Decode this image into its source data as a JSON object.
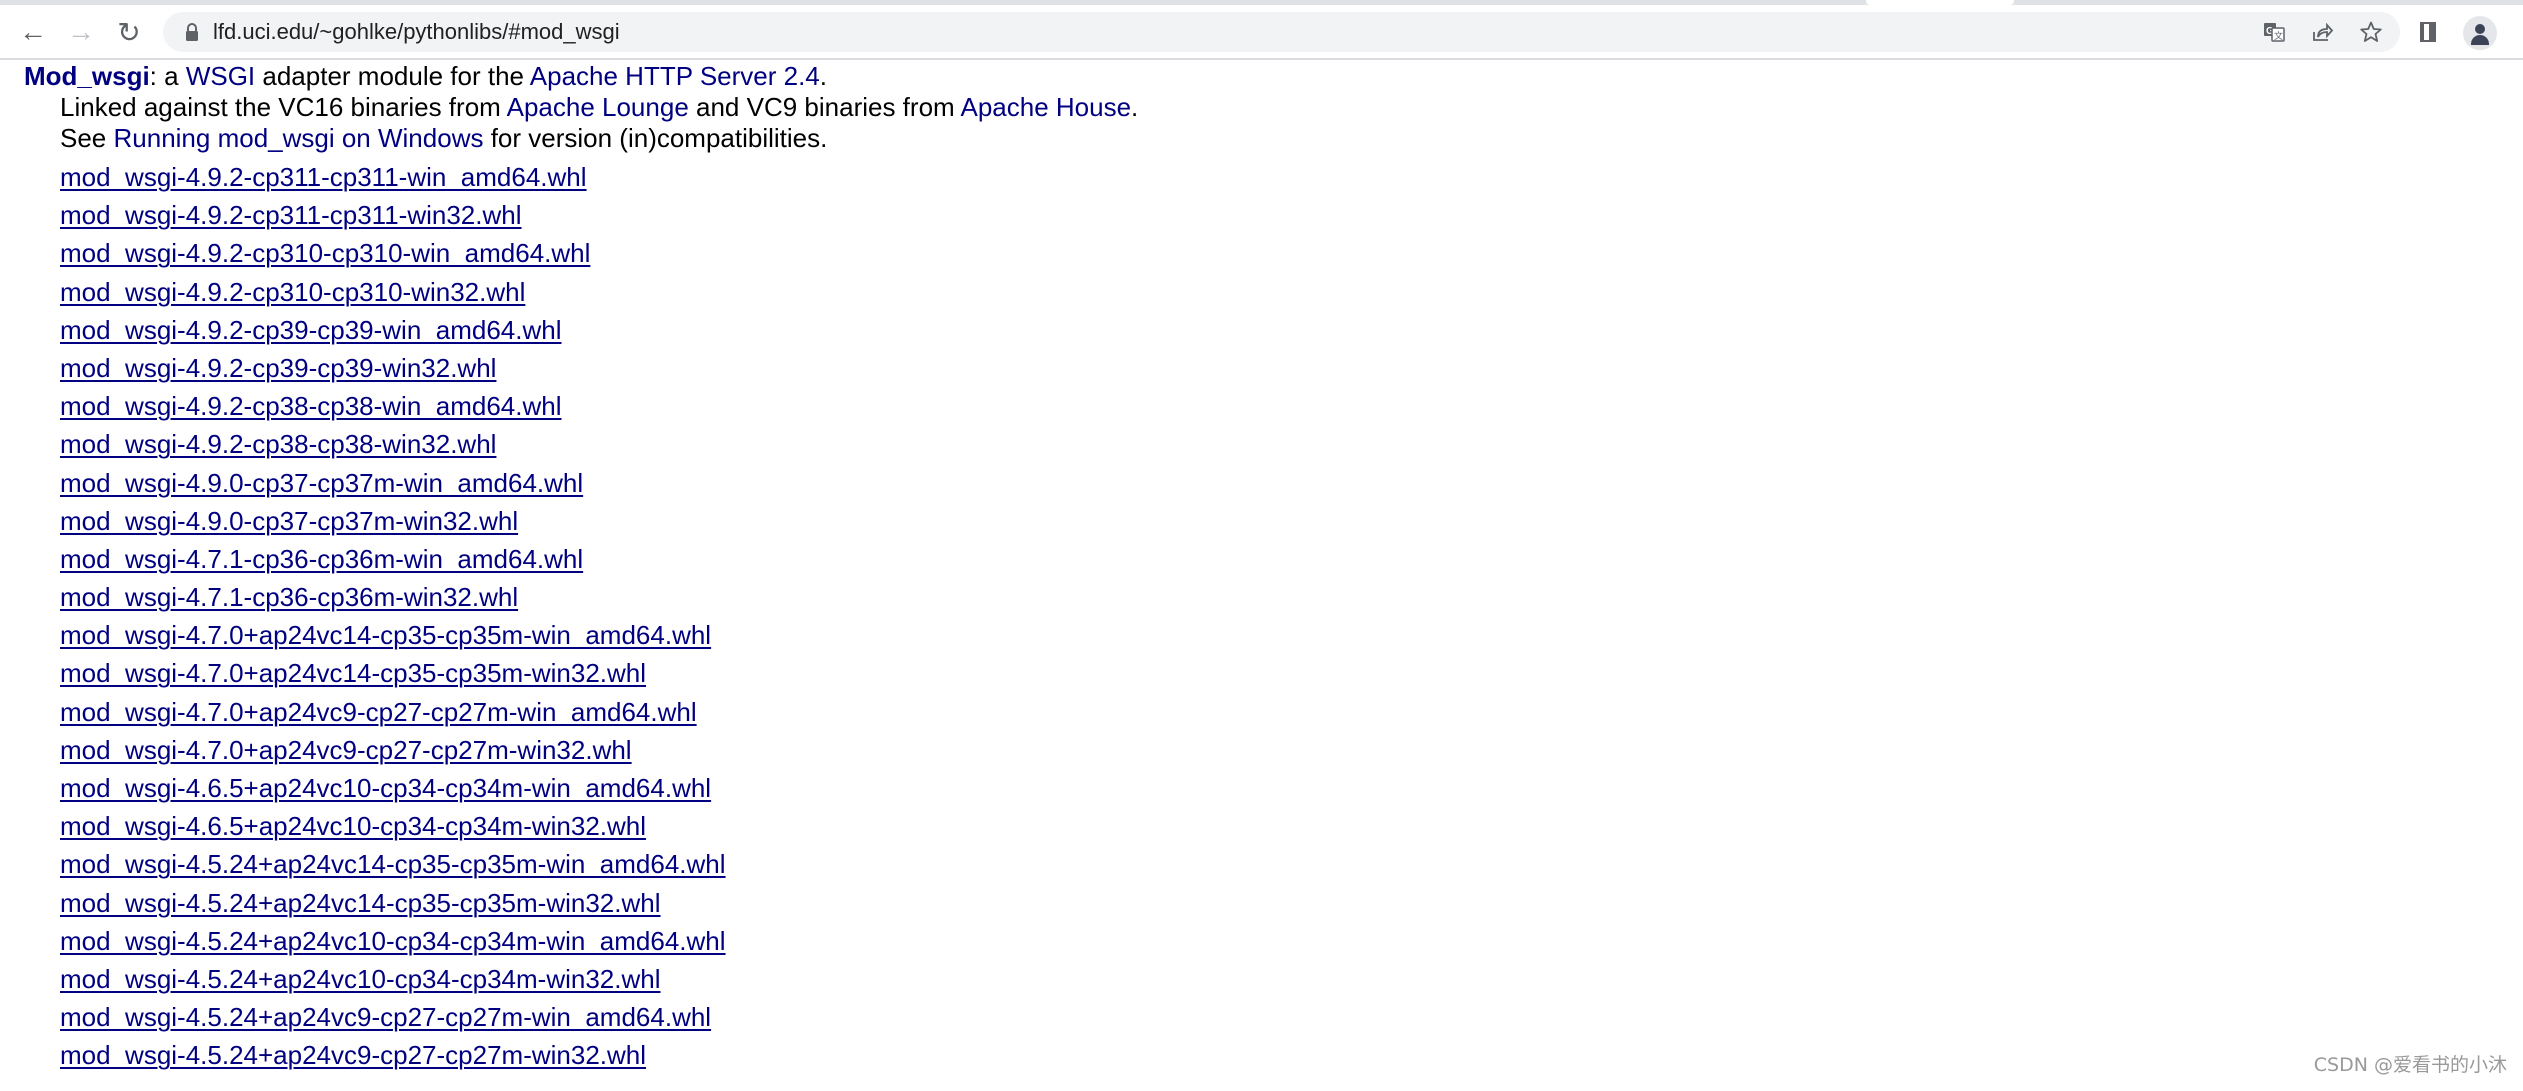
{
  "browser": {
    "url": "lfd.uci.edu/~gohlke/pythonlibs/#mod_wsgi",
    "nav": {
      "back_icon": "arrow-left-icon",
      "forward_icon": "arrow-right-icon",
      "reload_icon": "reload-icon"
    },
    "toolbar_icons": [
      "translate-icon",
      "share-icon",
      "bookmark-star-icon",
      "side-panel-icon",
      "profile-avatar-icon"
    ]
  },
  "page": {
    "header": {
      "title_link": "Mod_wsgi",
      "t1": ": a ",
      "wsgi_link": "WSGI",
      "t2": " adapter module for the ",
      "apache_link": "Apache HTTP Server 2.4",
      "t3": "."
    },
    "linked_line": {
      "t1": "Linked against the VC16 binaries from ",
      "lounge_link": "Apache Lounge",
      "t2": " and VC9 binaries from ",
      "house_link": "Apache House",
      "t3": "."
    },
    "see_line": {
      "t1": "See ",
      "running_link": "Running mod_wsgi on Windows",
      "t2": " for version (in)compatibilities."
    },
    "files": [
      "mod_wsgi-4.9.2-cp311-cp311-win_amd64.whl",
      "mod_wsgi-4.9.2-cp311-cp311-win32.whl",
      "mod_wsgi-4.9.2-cp310-cp310-win_amd64.whl",
      "mod_wsgi-4.9.2-cp310-cp310-win32.whl",
      "mod_wsgi-4.9.2-cp39-cp39-win_amd64.whl",
      "mod_wsgi-4.9.2-cp39-cp39-win32.whl",
      "mod_wsgi-4.9.2-cp38-cp38-win_amd64.whl",
      "mod_wsgi-4.9.2-cp38-cp38-win32.whl",
      "mod_wsgi-4.9.0-cp37-cp37m-win_amd64.whl",
      "mod_wsgi-4.9.0-cp37-cp37m-win32.whl",
      "mod_wsgi-4.7.1-cp36-cp36m-win_amd64.whl",
      "mod_wsgi-4.7.1-cp36-cp36m-win32.whl",
      "mod_wsgi-4.7.0+ap24vc14-cp35-cp35m-win_amd64.whl",
      "mod_wsgi-4.7.0+ap24vc14-cp35-cp35m-win32.whl",
      "mod_wsgi-4.7.0+ap24vc9-cp27-cp27m-win_amd64.whl",
      "mod_wsgi-4.7.0+ap24vc9-cp27-cp27m-win32.whl",
      "mod_wsgi-4.6.5+ap24vc10-cp34-cp34m-win_amd64.whl",
      "mod_wsgi-4.6.5+ap24vc10-cp34-cp34m-win32.whl",
      "mod_wsgi-4.5.24+ap24vc14-cp35-cp35m-win_amd64.whl",
      "mod_wsgi-4.5.24+ap24vc14-cp35-cp35m-win32.whl",
      "mod_wsgi-4.5.24+ap24vc10-cp34-cp34m-win_amd64.whl",
      "mod_wsgi-4.5.24+ap24vc10-cp34-cp34m-win32.whl",
      "mod_wsgi-4.5.24+ap24vc9-cp27-cp27m-win_amd64.whl",
      "mod_wsgi-4.5.24+ap24vc9-cp27-cp27m-win32.whl"
    ],
    "link_color": "#000080"
  },
  "watermark": "CSDN @爱看书的小沐"
}
